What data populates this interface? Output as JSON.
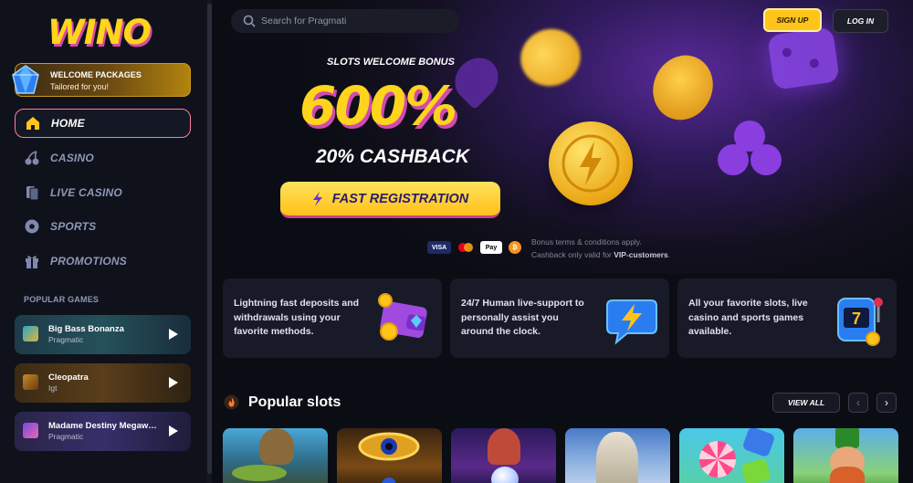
{
  "brand": {
    "logo_text": "WINO"
  },
  "sidebar": {
    "welcome": {
      "title": "WELCOME PACKAGES",
      "subtitle": "Tailored for you!"
    },
    "nav": [
      {
        "label": "HOME",
        "icon": "home-icon",
        "active": true
      },
      {
        "label": "CASINO",
        "icon": "cherry-icon"
      },
      {
        "label": "LIVE CASINO",
        "icon": "cards-icon"
      },
      {
        "label": "SPORTS",
        "icon": "soccer-ball-icon"
      },
      {
        "label": "PROMOTIONS",
        "icon": "gift-icon"
      }
    ],
    "popular_title": "POPULAR GAMES",
    "popular": [
      {
        "name": "Big Bass Bonanza",
        "provider": "Pragmatic"
      },
      {
        "name": "Cleopatra",
        "provider": "Igt"
      },
      {
        "name": "Madame Destiny Megaw…",
        "provider": "Pragmatic"
      }
    ]
  },
  "header": {
    "search": {
      "placeholder": "Search for Pragmati"
    },
    "signup_label": "SIGN UP",
    "login_label": "LOG IN"
  },
  "hero": {
    "subtitle": "SLOTS WELCOME BONUS",
    "big": "600%",
    "cashback": "20% CASHBACK",
    "cta_label": "FAST REGISTRATION",
    "payments": [
      "VISA",
      "Mastercard",
      "Apple Pay",
      "Bitcoin"
    ],
    "terms_line1": "Bonus terms & conditions apply.",
    "terms_line2_prefix": "Cashback only valid for ",
    "terms_line2_bold": "VIP-customers",
    "terms_line2_suffix": "."
  },
  "features": [
    {
      "text": "Lightning fast deposits and withdrawals using your favorite methods.",
      "icon": "wallet-icon"
    },
    {
      "text": "24/7 Human live-support to personally assist you around the clock.",
      "icon": "chat-lightning-icon"
    },
    {
      "text": "All your favorite slots, live casino and sports games available.",
      "icon": "slot-machine-icon"
    }
  ],
  "popular_slots": {
    "title": "Popular slots",
    "view_all_label": "VIEW ALL",
    "prev_label": "‹",
    "next_label": "›"
  },
  "colors": {
    "accent": "#ffd41c",
    "pink": "#d94aa6",
    "purple": "#5a2a9a",
    "bg": "#0b0d14"
  }
}
